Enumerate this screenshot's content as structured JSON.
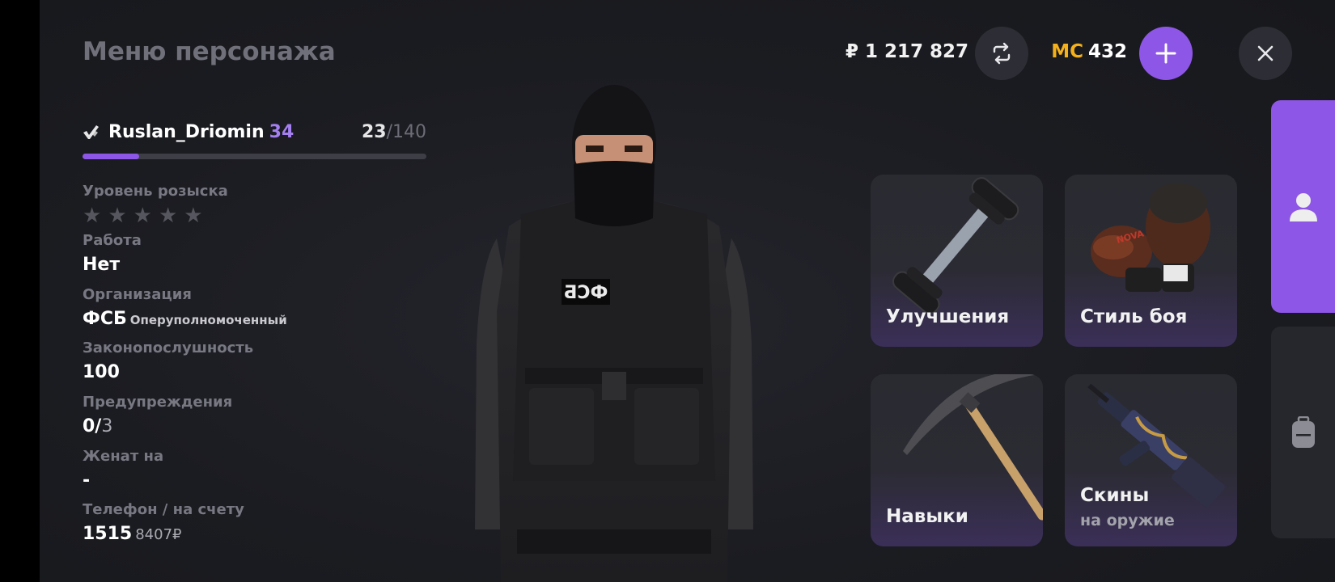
{
  "header": {
    "title": "Меню персонажа",
    "money": "₽ 1 217 827",
    "mc_label": "MC",
    "mc_value": "432"
  },
  "player": {
    "name": "Ruslan_Driomin",
    "level": "34",
    "exp_current": "23",
    "exp_max": "/140",
    "exp_progress": 0.164
  },
  "info": {
    "wanted_label": "Уровень розыска",
    "wanted_stars": 0,
    "wanted_stars_max": 5,
    "job_label": "Работа",
    "job_value": "Нет",
    "org_label": "Организация",
    "org_value": "ФСБ",
    "org_rank": "Оперуполномоченный",
    "law_label": "Законопослушность",
    "law_value": "100",
    "warn_label": "Предупреждения",
    "warn_value": "0/",
    "warn_max": "3",
    "married_label": "Женат на",
    "married_value": "-",
    "phone_label": "Телефон / на счету",
    "phone_value": "1515",
    "phone_balance": "8407₽"
  },
  "character": {
    "patch_text": "ФСБ"
  },
  "cards": {
    "upgrades": "Улучшения",
    "fight_style": "Стиль боя",
    "skills": "Навыки",
    "skins": "Скины",
    "skins_sub": "на оружие"
  },
  "colors": {
    "accent": "#8e56e6",
    "mc": "#f5b01a",
    "level": "#a47ff0",
    "background": "#1b1c21"
  },
  "icons": [
    "exchange-icon",
    "plus-icon",
    "close-icon",
    "verified-icon",
    "user-icon",
    "backpack-icon"
  ]
}
